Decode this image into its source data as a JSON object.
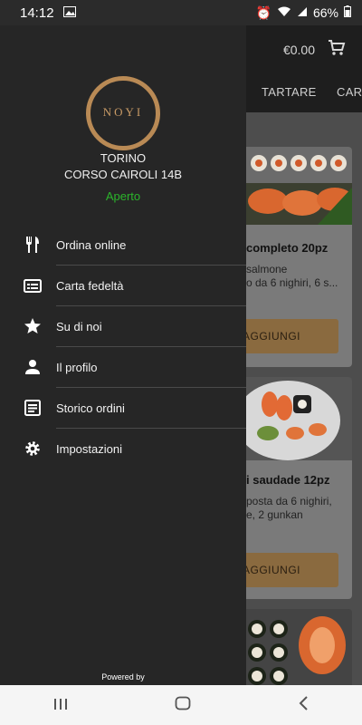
{
  "status": {
    "time": "14:12",
    "battery": "66%"
  },
  "app": {
    "cart_total": "€0.00",
    "tabs": [
      "TARTARE",
      "CARP"
    ],
    "cards": [
      {
        "title": "completo 20pz",
        "desc_line1": "salmone",
        "desc_line2": "o da 6 nighiri, 6 s...",
        "button": "AGGIUNGI"
      },
      {
        "title": "i saudade 12pz",
        "desc_line1": "posta da 6 nighiri,",
        "desc_line2": "e, 2 gunkan",
        "button": "AGGIUNGI"
      }
    ]
  },
  "drawer": {
    "logo_name": "NOYI",
    "city": "TORINO",
    "address": "CORSO CAIROLI 14B",
    "status": "Aperto",
    "menu": [
      {
        "label": "Ordina online",
        "icon": "cutlery-icon"
      },
      {
        "label": "Carta fedeltà",
        "icon": "card-icon"
      },
      {
        "label": "Su di noi",
        "icon": "star-icon"
      },
      {
        "label": "Il profilo",
        "icon": "person-icon"
      },
      {
        "label": "Storico ordini",
        "icon": "receipt-icon"
      },
      {
        "label": "Impostazioni",
        "icon": "gear-icon"
      }
    ],
    "powered": "Powered by"
  },
  "colors": {
    "drawer_bg": "#262626",
    "accent": "#b98a55",
    "open_green": "#2bb52b"
  }
}
